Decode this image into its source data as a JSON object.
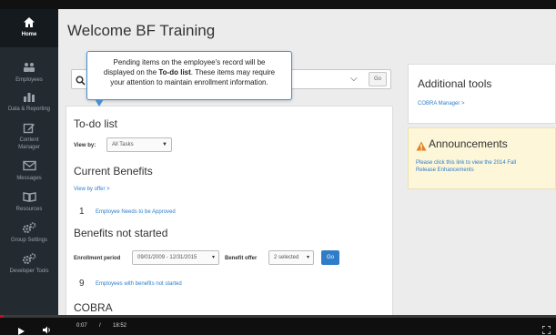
{
  "sidebar": {
    "home": "Home",
    "items": [
      {
        "label": "Employees",
        "icon": "people-icon"
      },
      {
        "label": "Data & Reporting",
        "icon": "bar-chart-icon"
      },
      {
        "label": "Content Manager",
        "icon": "edit-icon"
      },
      {
        "label": "Messages",
        "icon": "envelope-icon"
      },
      {
        "label": "Resources",
        "icon": "book-icon"
      },
      {
        "label": "Group Settings",
        "icon": "gears-icon"
      },
      {
        "label": "Developer Tools",
        "icon": "gears-icon"
      }
    ]
  },
  "header": {
    "title": "Welcome BF Training"
  },
  "search": {
    "go_label": "Go"
  },
  "tooltip": {
    "line1": "Pending items on the employee's record will be",
    "line2_a": "displayed on the ",
    "line2_b": "To-do list",
    "line2_c": ". These items may require",
    "line3": "your attention to maintain enrollment information."
  },
  "todo": {
    "title": "To-do list",
    "view_by_label": "View by:",
    "view_by_value": "All Tasks"
  },
  "current_benefits": {
    "title": "Current Benefits",
    "view_by_offer": "View by offer >",
    "count": "1",
    "item": "Employee Needs to be Approved"
  },
  "benefits_not_started": {
    "title": "Benefits not started",
    "enrollment_label": "Enrollment period",
    "enrollment_value": "09/01/2009 - 12/31/2015",
    "offer_label": "Benefit offer",
    "offer_value": "2 selected",
    "go_label": "Go",
    "count": "9",
    "item": "Employees with benefits not started"
  },
  "cobra": {
    "title": "COBRA"
  },
  "tools": {
    "title": "Additional tools",
    "link": "COBRA Manager >"
  },
  "announcements": {
    "title": "Announcements",
    "line1": "Please click this link to view the 2014 Fall",
    "line2": "Release Enhancements"
  },
  "player": {
    "current": "0:07",
    "separator": "/",
    "duration": "18:52",
    "progress": 0.006
  },
  "colors": {
    "sidebar": "#232a30",
    "accent": "#2f7dc8",
    "tooltip_border": "#4a8fd2",
    "announcement_bg": "#fdf6d9",
    "progress": "#c1121c"
  }
}
